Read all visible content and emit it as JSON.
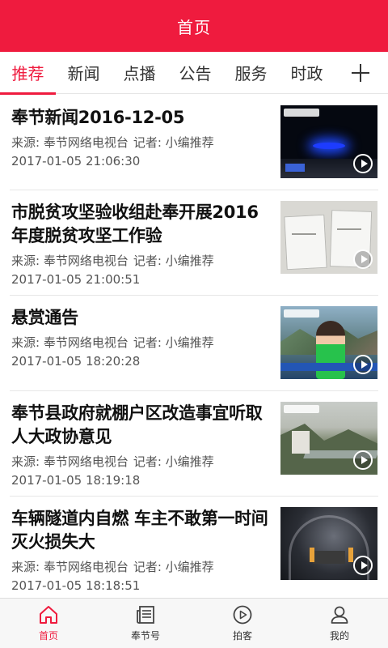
{
  "header": {
    "title": "首页"
  },
  "tabs": [
    {
      "label": "推荐"
    },
    {
      "label": "新闻"
    },
    {
      "label": "点播"
    },
    {
      "label": "公告"
    },
    {
      "label": "服务"
    },
    {
      "label": "时政"
    }
  ],
  "add_tab_icon": "plus-icon",
  "news": [
    {
      "title": "奉节新闻2016-12-05",
      "source": "来源: 奉节网络电视台",
      "reporter": "记者: 小编推荐",
      "time": "2017-01-05 21:06:30"
    },
    {
      "title": "市脱贫攻坚验收组赴奉开展2016年度脱贫攻坚工作验",
      "source": "来源: 奉节网络电视台",
      "reporter": "记者: 小编推荐",
      "time": "2017-01-05 21:00:51"
    },
    {
      "title": "悬赏通告",
      "source": "来源: 奉节网络电视台",
      "reporter": "记者: 小编推荐",
      "time": "2017-01-05 18:20:28"
    },
    {
      "title": "奉节县政府就棚户区改造事宜听取人大政协意见",
      "source": "来源: 奉节网络电视台",
      "reporter": "记者: 小编推荐",
      "time": "2017-01-05 18:19:18"
    },
    {
      "title": "车辆隧道内自燃 车主不敢第一时间灭火损失大",
      "source": "来源: 奉节网络电视台",
      "reporter": "记者: 小编推荐",
      "time": "2017-01-05 18:18:51"
    }
  ],
  "tabbar": [
    {
      "label": "首页",
      "icon": "home-icon",
      "active": true
    },
    {
      "label": "奉节号",
      "icon": "newspaper-icon",
      "active": false
    },
    {
      "label": "拍客",
      "icon": "play-circle-icon",
      "active": false
    },
    {
      "label": "我的",
      "icon": "user-icon",
      "active": false
    }
  ],
  "colors": {
    "accent": "#ef1b3e"
  }
}
